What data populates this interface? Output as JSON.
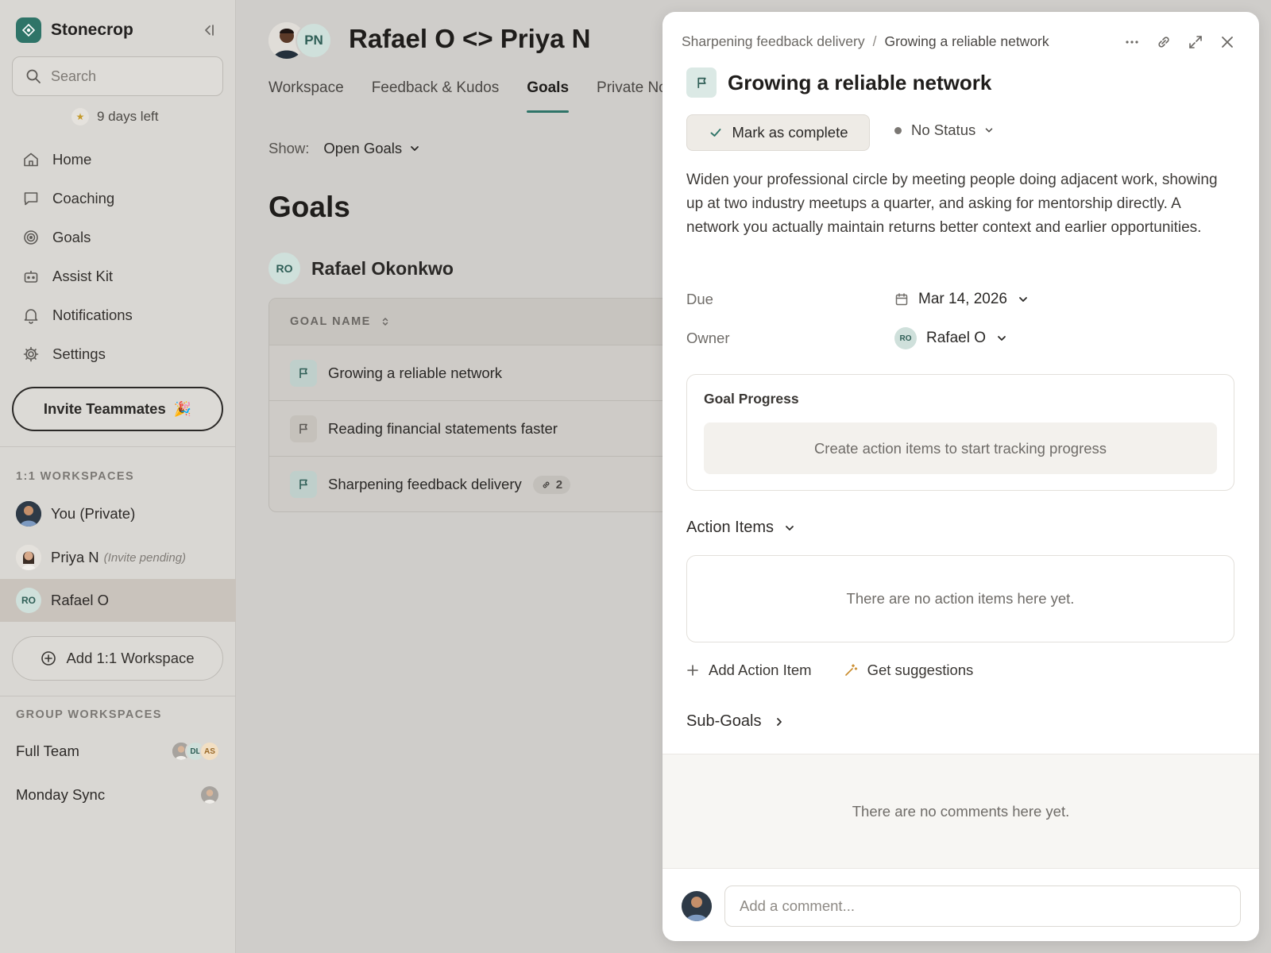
{
  "sidebar": {
    "brand": "Stonecrop",
    "search_placeholder": "Search",
    "trial": "9 days left",
    "nav": [
      {
        "label": "Home",
        "icon": "home-icon"
      },
      {
        "label": "Coaching",
        "icon": "chat-icon"
      },
      {
        "label": "Goals",
        "icon": "target-icon"
      },
      {
        "label": "Assist Kit",
        "icon": "robot-icon"
      },
      {
        "label": "Notifications",
        "icon": "bell-icon"
      },
      {
        "label": "Settings",
        "icon": "gear-icon"
      }
    ],
    "invite_label": "Invite Teammates",
    "one_on_one_label": "1:1 WORKSPACES",
    "workspaces": [
      {
        "label": "You (Private)"
      },
      {
        "label": "Priya N",
        "note": "(Invite pending)"
      },
      {
        "label": "Rafael O",
        "initials": "RO",
        "active": true
      }
    ],
    "add_workspace_label": "Add 1:1 Workspace",
    "group_label": "GROUP WORKSPACES",
    "groups": [
      {
        "label": "Full Team",
        "members": [
          "",
          "DL",
          "AS"
        ]
      },
      {
        "label": "Monday Sync"
      }
    ]
  },
  "main": {
    "header_initials": "PN",
    "title": "Rafael O <> Priya N",
    "tabs": [
      "Workspace",
      "Feedback & Kudos",
      "Goals",
      "Private No"
    ],
    "active_tab": 2,
    "show_label": "Show:",
    "show_value": "Open Goals",
    "heading": "Goals",
    "owner_initials": "RO",
    "owner_name": "Rafael Okonkwo",
    "table_header": "GOAL NAME",
    "goals": [
      {
        "name": "Growing a reliable network"
      },
      {
        "name": "Reading financial statements faster"
      },
      {
        "name": "Sharpening feedback delivery",
        "link_count": "2"
      }
    ]
  },
  "panel": {
    "breadcrumb_parent": "Sharpening feedback delivery",
    "breadcrumb_sep": "/",
    "breadcrumb_current": "Growing a reliable network",
    "title": "Growing a reliable network",
    "complete_label": "Mark as complete",
    "status_label": "No Status",
    "description": "Widen your professional circle by meeting people doing adjacent work, showing up at two industry meetups a quarter, and asking for mentorship directly. A network you actually maintain returns better context and earlier opportunities.",
    "due_label": "Due",
    "due_value": "Mar 14, 2026",
    "owner_label": "Owner",
    "owner_initials": "RO",
    "owner_value": "Rafael O",
    "progress_title": "Goal Progress",
    "progress_empty": "Create action items to start tracking progress",
    "action_items_label": "Action Items",
    "action_items_empty": "There are no action items here yet.",
    "add_action_label": "Add Action Item",
    "suggestions_label": "Get suggestions",
    "subgoals_label": "Sub-Goals",
    "comments_empty": "There are no comments here yet.",
    "comment_placeholder": "Add a comment..."
  },
  "colors": {
    "accent": "#2f7468",
    "sidebar_bg": "#d9d7d3",
    "panel_bg": "#ffffff"
  }
}
